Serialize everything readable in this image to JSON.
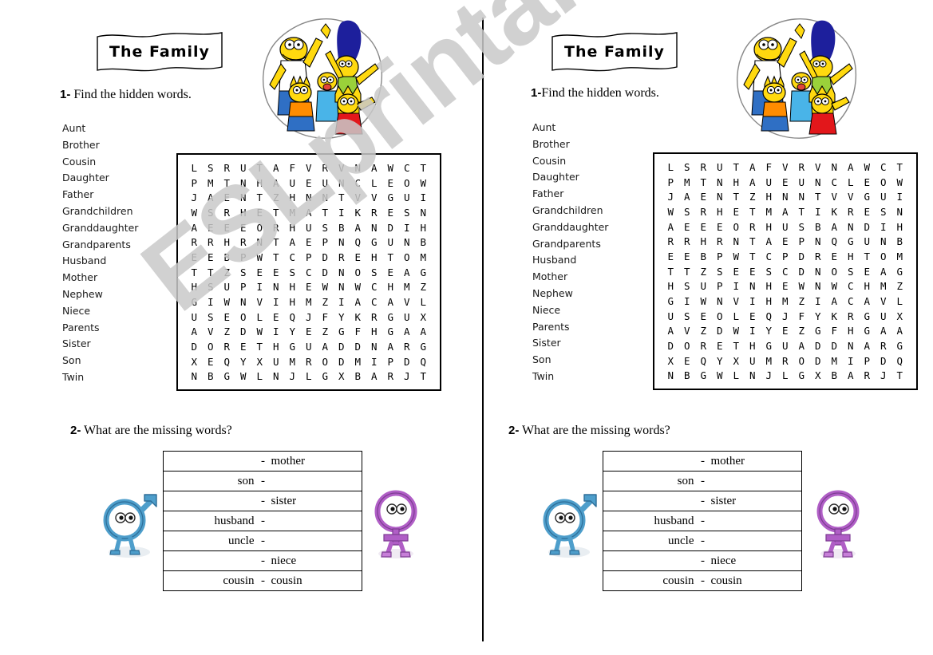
{
  "watermark": {
    "text": "ESLprintables.com"
  },
  "worksheet": {
    "banner_title": "The Family",
    "task1_number": "1-",
    "task1_text": " Find the hidden words.",
    "task1_number_right": "1-",
    "task1_text_right": "Find the hidden words.",
    "task2_number": "2-",
    "task2_text": " What are the missing words?",
    "words": [
      "Aunt",
      "Brother",
      "Cousin",
      "Daughter",
      "Father",
      "Grandchildren",
      "Granddaughter",
      "Grandparents",
      "Husband",
      "Mother",
      "Nephew",
      "Niece",
      "Parents",
      "Sister",
      "Son",
      "Twin"
    ],
    "grid": [
      [
        "L",
        "S",
        "R",
        "U",
        "T",
        "A",
        "F",
        "V",
        "R",
        "V",
        "N",
        "A",
        "W",
        "C",
        "T"
      ],
      [
        "P",
        "M",
        "T",
        "N",
        "H",
        "A",
        "U",
        "E",
        "U",
        "N",
        "C",
        "L",
        "E",
        "O",
        "W"
      ],
      [
        "J",
        "A",
        "E",
        "N",
        "T",
        "Z",
        "H",
        "N",
        "N",
        "T",
        "V",
        "V",
        "G",
        "U",
        "I"
      ],
      [
        "W",
        "S",
        "R",
        "H",
        "E",
        "T",
        "M",
        "A",
        "T",
        "I",
        "K",
        "R",
        "E",
        "S",
        "N"
      ],
      [
        "A",
        "E",
        "E",
        "E",
        "O",
        "R",
        "H",
        "U",
        "S",
        "B",
        "A",
        "N",
        "D",
        "I",
        "H"
      ],
      [
        "R",
        "R",
        "H",
        "R",
        "N",
        "T",
        "A",
        "E",
        "P",
        "N",
        "Q",
        "G",
        "U",
        "N",
        "B"
      ],
      [
        "E",
        "E",
        "B",
        "P",
        "W",
        "T",
        "C",
        "P",
        "D",
        "R",
        "E",
        "H",
        "T",
        "O",
        "M"
      ],
      [
        "T",
        "T",
        "Z",
        "S",
        "E",
        "E",
        "S",
        "C",
        "D",
        "N",
        "O",
        "S",
        "E",
        "A",
        "G"
      ],
      [
        "H",
        "S",
        "U",
        "P",
        "I",
        "N",
        "H",
        "E",
        "W",
        "N",
        "W",
        "C",
        "H",
        "M",
        "Z"
      ],
      [
        "G",
        "I",
        "W",
        "N",
        "V",
        "I",
        "H",
        "M",
        "Z",
        "I",
        "A",
        "C",
        "A",
        "V",
        "L"
      ],
      [
        "U",
        "S",
        "E",
        "O",
        "L",
        "E",
        "Q",
        "J",
        "F",
        "Y",
        "K",
        "R",
        "G",
        "U",
        "X"
      ],
      [
        "A",
        "V",
        "Z",
        "D",
        "W",
        "I",
        "Y",
        "E",
        "Z",
        "G",
        "F",
        "H",
        "G",
        "A",
        "A"
      ],
      [
        "D",
        "O",
        "R",
        "E",
        "T",
        "H",
        "G",
        "U",
        "A",
        "D",
        "D",
        "N",
        "A",
        "R",
        "G"
      ],
      [
        "X",
        "E",
        "Q",
        "Y",
        "X",
        "U",
        "M",
        "R",
        "O",
        "D",
        "M",
        "I",
        "P",
        "D",
        "Q"
      ],
      [
        "N",
        "B",
        "G",
        "W",
        "L",
        "N",
        "J",
        "L",
        "G",
        "X",
        "B",
        "A",
        "R",
        "J",
        "T"
      ]
    ],
    "answer_rows": [
      {
        "left": "",
        "dash": "-",
        "right": "mother"
      },
      {
        "left": "son",
        "dash": "-",
        "right": ""
      },
      {
        "left": "",
        "dash": "-",
        "right": "sister"
      },
      {
        "left": "husband",
        "dash": "-",
        "right": ""
      },
      {
        "left": "uncle",
        "dash": "-",
        "right": ""
      },
      {
        "left": "",
        "dash": "-",
        "right": "niece"
      },
      {
        "left": "cousin",
        "dash": "-",
        "right": "cousin"
      }
    ],
    "male_figure_name": "male-symbol-character",
    "female_figure_name": "female-symbol-character",
    "clipart_name": "simpsons-family-clipart",
    "colors": {
      "male": "#4e9ecb",
      "female": "#b05ec6",
      "ink": "#000000",
      "watermark": "#c9c9c9"
    }
  }
}
